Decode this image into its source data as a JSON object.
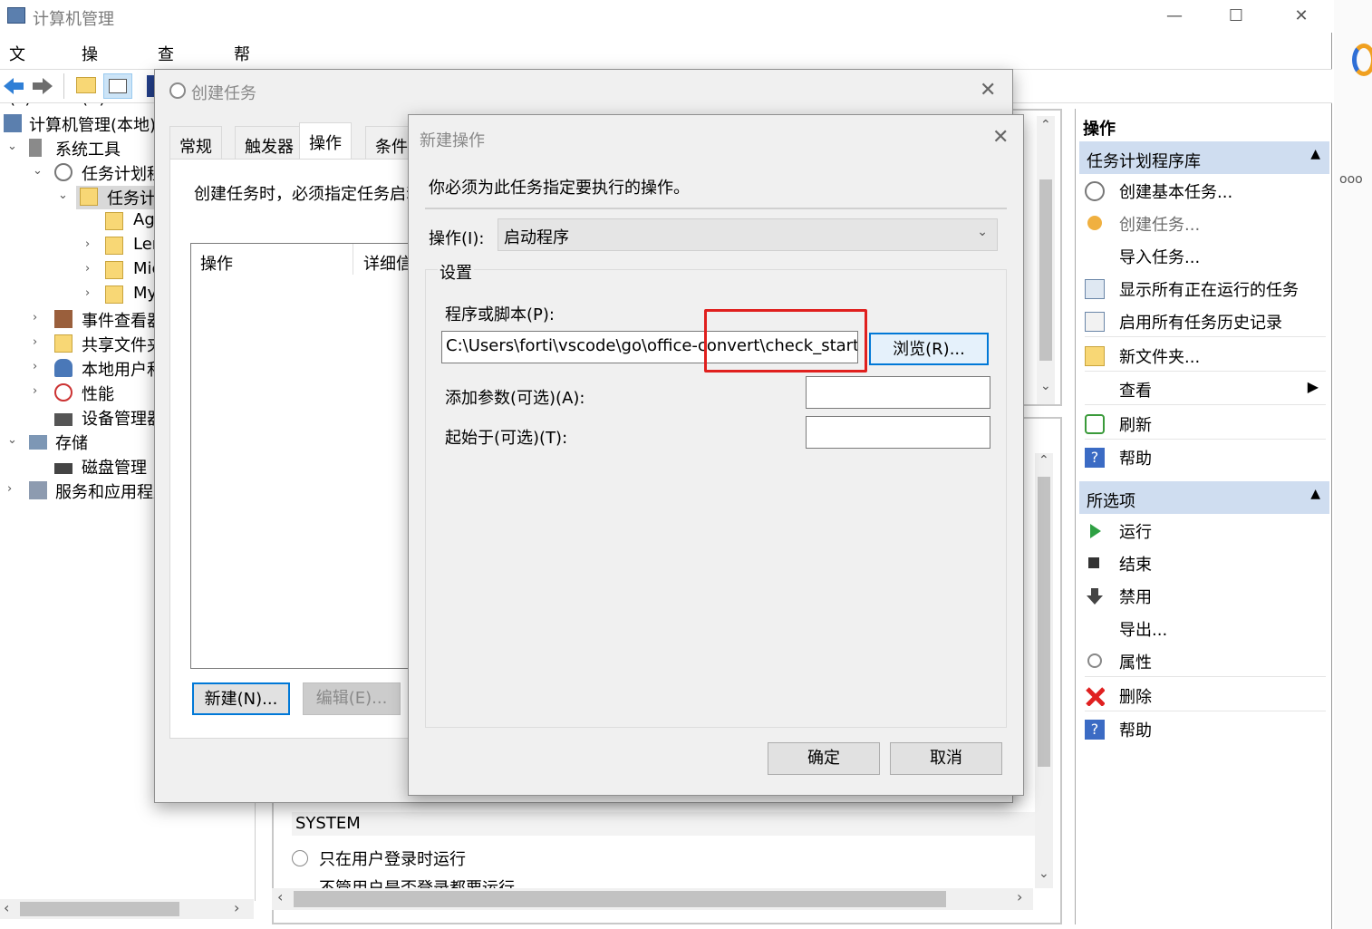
{
  "window": {
    "title": "计算机管理",
    "minimize": "—",
    "maximize": "☐",
    "close": "✕"
  },
  "menu": [
    "文件(F)",
    "操作(A)",
    "查看(V)",
    "帮助(H)"
  ],
  "tree": {
    "root": "计算机管理(本地)",
    "system_tools": "系统工具",
    "task_scheduler": "任务计划程序",
    "task_library": "任务计划程序库",
    "folders": [
      "Ag",
      "Ler",
      "Mic",
      "My"
    ],
    "event_viewer": "事件查看器",
    "shared_folders": "共享文件夹",
    "local_users": "本地用户和组",
    "performance": "性能",
    "device_manager": "设备管理器",
    "storage": "存储",
    "disk_mgmt": "磁盘管理",
    "services_apps": "服务和应用程序"
  },
  "background": {
    "account": "SYSTEM",
    "radio1": "只在用户登录时运行",
    "radio2": "不管用户是否登录都要运行"
  },
  "create_dialog": {
    "title": "创建任务",
    "tabs": [
      "常规",
      "触发器",
      "操作",
      "条件"
    ],
    "hint": "创建任务时，必须指定任务启动时发生的操作。",
    "col_action": "操作",
    "col_detail": "详细信息",
    "new_btn": "新建(N)...",
    "edit_btn": "编辑(E)..."
  },
  "new_action": {
    "title": "新建操作",
    "instruction": "你必须为此任务指定要执行的操作。",
    "action_label": "操作(I):",
    "action_value": "启动程序",
    "settings_label": "设置",
    "program_label": "程序或脚本(P):",
    "program_value": "C:\\Users\\forti\\vscode\\go\\office-convert\\check_start.bat",
    "browse_btn": "浏览(R)...",
    "args_label": "添加参数(可选)(A):",
    "args_value": "",
    "start_in_label": "起始于(可选)(T):",
    "start_in_value": "",
    "ok_btn": "确定",
    "cancel_btn": "取消"
  },
  "actions_pane": {
    "header": "操作",
    "section1": "任务计划程序库",
    "items1": [
      "创建基本任务...",
      "创建任务...",
      "导入任务...",
      "显示所有正在运行的任务",
      "启用所有任务历史记录",
      "新文件夹...",
      "查看",
      "刷新",
      "帮助"
    ],
    "section2": "所选项",
    "items2": [
      "运行",
      "结束",
      "禁用",
      "导出...",
      "属性",
      "删除",
      "帮助"
    ]
  }
}
